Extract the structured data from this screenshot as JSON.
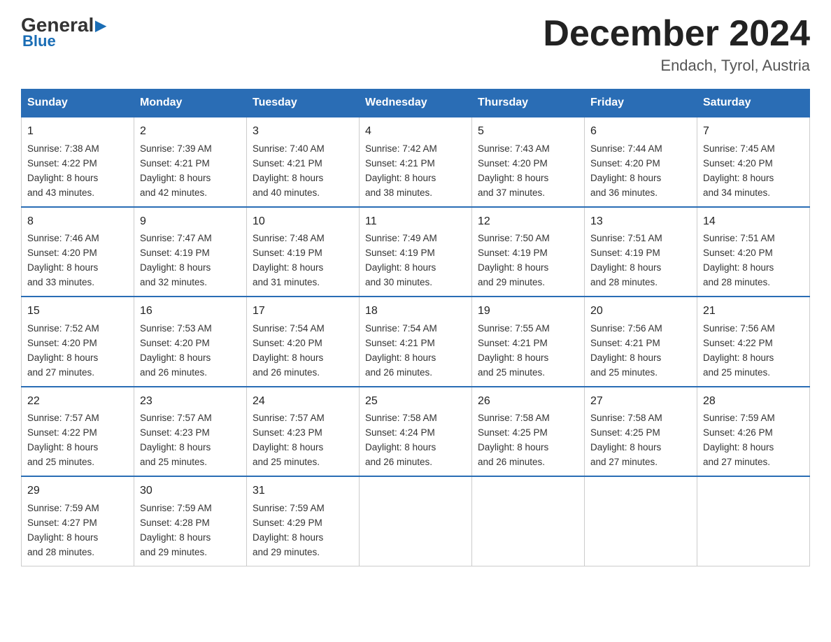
{
  "logo": {
    "general": "General",
    "blue": "Blue",
    "subtitle": "Blue"
  },
  "header": {
    "title": "December 2024",
    "location": "Endach, Tyrol, Austria"
  },
  "days_of_week": [
    "Sunday",
    "Monday",
    "Tuesday",
    "Wednesday",
    "Thursday",
    "Friday",
    "Saturday"
  ],
  "weeks": [
    [
      {
        "day": "1",
        "sunrise": "Sunrise: 7:38 AM",
        "sunset": "Sunset: 4:22 PM",
        "daylight": "Daylight: 8 hours",
        "daylight2": "and 43 minutes."
      },
      {
        "day": "2",
        "sunrise": "Sunrise: 7:39 AM",
        "sunset": "Sunset: 4:21 PM",
        "daylight": "Daylight: 8 hours",
        "daylight2": "and 42 minutes."
      },
      {
        "day": "3",
        "sunrise": "Sunrise: 7:40 AM",
        "sunset": "Sunset: 4:21 PM",
        "daylight": "Daylight: 8 hours",
        "daylight2": "and 40 minutes."
      },
      {
        "day": "4",
        "sunrise": "Sunrise: 7:42 AM",
        "sunset": "Sunset: 4:21 PM",
        "daylight": "Daylight: 8 hours",
        "daylight2": "and 38 minutes."
      },
      {
        "day": "5",
        "sunrise": "Sunrise: 7:43 AM",
        "sunset": "Sunset: 4:20 PM",
        "daylight": "Daylight: 8 hours",
        "daylight2": "and 37 minutes."
      },
      {
        "day": "6",
        "sunrise": "Sunrise: 7:44 AM",
        "sunset": "Sunset: 4:20 PM",
        "daylight": "Daylight: 8 hours",
        "daylight2": "and 36 minutes."
      },
      {
        "day": "7",
        "sunrise": "Sunrise: 7:45 AM",
        "sunset": "Sunset: 4:20 PM",
        "daylight": "Daylight: 8 hours",
        "daylight2": "and 34 minutes."
      }
    ],
    [
      {
        "day": "8",
        "sunrise": "Sunrise: 7:46 AM",
        "sunset": "Sunset: 4:20 PM",
        "daylight": "Daylight: 8 hours",
        "daylight2": "and 33 minutes."
      },
      {
        "day": "9",
        "sunrise": "Sunrise: 7:47 AM",
        "sunset": "Sunset: 4:19 PM",
        "daylight": "Daylight: 8 hours",
        "daylight2": "and 32 minutes."
      },
      {
        "day": "10",
        "sunrise": "Sunrise: 7:48 AM",
        "sunset": "Sunset: 4:19 PM",
        "daylight": "Daylight: 8 hours",
        "daylight2": "and 31 minutes."
      },
      {
        "day": "11",
        "sunrise": "Sunrise: 7:49 AM",
        "sunset": "Sunset: 4:19 PM",
        "daylight": "Daylight: 8 hours",
        "daylight2": "and 30 minutes."
      },
      {
        "day": "12",
        "sunrise": "Sunrise: 7:50 AM",
        "sunset": "Sunset: 4:19 PM",
        "daylight": "Daylight: 8 hours",
        "daylight2": "and 29 minutes."
      },
      {
        "day": "13",
        "sunrise": "Sunrise: 7:51 AM",
        "sunset": "Sunset: 4:19 PM",
        "daylight": "Daylight: 8 hours",
        "daylight2": "and 28 minutes."
      },
      {
        "day": "14",
        "sunrise": "Sunrise: 7:51 AM",
        "sunset": "Sunset: 4:20 PM",
        "daylight": "Daylight: 8 hours",
        "daylight2": "and 28 minutes."
      }
    ],
    [
      {
        "day": "15",
        "sunrise": "Sunrise: 7:52 AM",
        "sunset": "Sunset: 4:20 PM",
        "daylight": "Daylight: 8 hours",
        "daylight2": "and 27 minutes."
      },
      {
        "day": "16",
        "sunrise": "Sunrise: 7:53 AM",
        "sunset": "Sunset: 4:20 PM",
        "daylight": "Daylight: 8 hours",
        "daylight2": "and 26 minutes."
      },
      {
        "day": "17",
        "sunrise": "Sunrise: 7:54 AM",
        "sunset": "Sunset: 4:20 PM",
        "daylight": "Daylight: 8 hours",
        "daylight2": "and 26 minutes."
      },
      {
        "day": "18",
        "sunrise": "Sunrise: 7:54 AM",
        "sunset": "Sunset: 4:21 PM",
        "daylight": "Daylight: 8 hours",
        "daylight2": "and 26 minutes."
      },
      {
        "day": "19",
        "sunrise": "Sunrise: 7:55 AM",
        "sunset": "Sunset: 4:21 PM",
        "daylight": "Daylight: 8 hours",
        "daylight2": "and 25 minutes."
      },
      {
        "day": "20",
        "sunrise": "Sunrise: 7:56 AM",
        "sunset": "Sunset: 4:21 PM",
        "daylight": "Daylight: 8 hours",
        "daylight2": "and 25 minutes."
      },
      {
        "day": "21",
        "sunrise": "Sunrise: 7:56 AM",
        "sunset": "Sunset: 4:22 PM",
        "daylight": "Daylight: 8 hours",
        "daylight2": "and 25 minutes."
      }
    ],
    [
      {
        "day": "22",
        "sunrise": "Sunrise: 7:57 AM",
        "sunset": "Sunset: 4:22 PM",
        "daylight": "Daylight: 8 hours",
        "daylight2": "and 25 minutes."
      },
      {
        "day": "23",
        "sunrise": "Sunrise: 7:57 AM",
        "sunset": "Sunset: 4:23 PM",
        "daylight": "Daylight: 8 hours",
        "daylight2": "and 25 minutes."
      },
      {
        "day": "24",
        "sunrise": "Sunrise: 7:57 AM",
        "sunset": "Sunset: 4:23 PM",
        "daylight": "Daylight: 8 hours",
        "daylight2": "and 25 minutes."
      },
      {
        "day": "25",
        "sunrise": "Sunrise: 7:58 AM",
        "sunset": "Sunset: 4:24 PM",
        "daylight": "Daylight: 8 hours",
        "daylight2": "and 26 minutes."
      },
      {
        "day": "26",
        "sunrise": "Sunrise: 7:58 AM",
        "sunset": "Sunset: 4:25 PM",
        "daylight": "Daylight: 8 hours",
        "daylight2": "and 26 minutes."
      },
      {
        "day": "27",
        "sunrise": "Sunrise: 7:58 AM",
        "sunset": "Sunset: 4:25 PM",
        "daylight": "Daylight: 8 hours",
        "daylight2": "and 27 minutes."
      },
      {
        "day": "28",
        "sunrise": "Sunrise: 7:59 AM",
        "sunset": "Sunset: 4:26 PM",
        "daylight": "Daylight: 8 hours",
        "daylight2": "and 27 minutes."
      }
    ],
    [
      {
        "day": "29",
        "sunrise": "Sunrise: 7:59 AM",
        "sunset": "Sunset: 4:27 PM",
        "daylight": "Daylight: 8 hours",
        "daylight2": "and 28 minutes."
      },
      {
        "day": "30",
        "sunrise": "Sunrise: 7:59 AM",
        "sunset": "Sunset: 4:28 PM",
        "daylight": "Daylight: 8 hours",
        "daylight2": "and 29 minutes."
      },
      {
        "day": "31",
        "sunrise": "Sunrise: 7:59 AM",
        "sunset": "Sunset: 4:29 PM",
        "daylight": "Daylight: 8 hours",
        "daylight2": "and 29 minutes."
      },
      {
        "day": "",
        "sunrise": "",
        "sunset": "",
        "daylight": "",
        "daylight2": ""
      },
      {
        "day": "",
        "sunrise": "",
        "sunset": "",
        "daylight": "",
        "daylight2": ""
      },
      {
        "day": "",
        "sunrise": "",
        "sunset": "",
        "daylight": "",
        "daylight2": ""
      },
      {
        "day": "",
        "sunrise": "",
        "sunset": "",
        "daylight": "",
        "daylight2": ""
      }
    ]
  ]
}
